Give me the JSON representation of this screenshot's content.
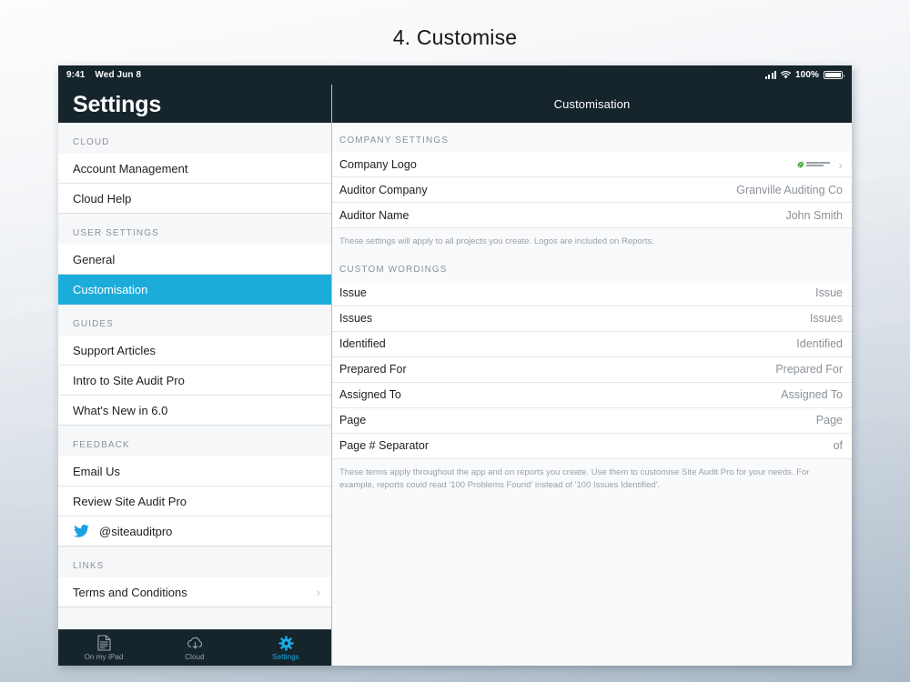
{
  "page": {
    "heading": "4. Customise"
  },
  "statusbar": {
    "time": "9:41",
    "date": "Wed Jun 8",
    "battery_pct": "100%",
    "signal_icon": "cellular-signal-icon",
    "wifi_icon": "wifi-icon",
    "battery_icon": "battery-icon"
  },
  "sidebar": {
    "title": "Settings",
    "sections": [
      {
        "header": "CLOUD",
        "items": [
          {
            "label": "Account Management",
            "selected": false,
            "chevron": false,
            "icon": null
          },
          {
            "label": "Cloud Help",
            "selected": false,
            "chevron": false,
            "icon": null
          }
        ]
      },
      {
        "header": "USER SETTINGS",
        "items": [
          {
            "label": "General",
            "selected": false,
            "chevron": false,
            "icon": null
          },
          {
            "label": "Customisation",
            "selected": true,
            "chevron": false,
            "icon": null
          }
        ]
      },
      {
        "header": "GUIDES",
        "items": [
          {
            "label": "Support Articles",
            "selected": false,
            "chevron": false,
            "icon": null
          },
          {
            "label": "Intro to Site Audit Pro",
            "selected": false,
            "chevron": false,
            "icon": null
          },
          {
            "label": "What's New in 6.0",
            "selected": false,
            "chevron": false,
            "icon": null
          }
        ]
      },
      {
        "header": "FEEDBACK",
        "items": [
          {
            "label": "Email Us",
            "selected": false,
            "chevron": false,
            "icon": null
          },
          {
            "label": "Review Site Audit Pro",
            "selected": false,
            "chevron": false,
            "icon": null
          },
          {
            "label": "@siteauditpro",
            "selected": false,
            "chevron": false,
            "icon": "twitter-icon"
          }
        ]
      },
      {
        "header": "LINKS",
        "items": [
          {
            "label": "Terms and Conditions",
            "selected": false,
            "chevron": true,
            "icon": null
          }
        ]
      }
    ]
  },
  "tabbar": {
    "tabs": [
      {
        "label": "On my iPad",
        "icon": "document-icon",
        "active": false
      },
      {
        "label": "Cloud",
        "icon": "cloud-icon",
        "active": false
      },
      {
        "label": "Settings",
        "icon": "gear-icon",
        "active": true
      }
    ]
  },
  "panel": {
    "nav_title": "Customisation",
    "sections": [
      {
        "header": "COMPANY SETTINGS",
        "footnote": "These settings will apply to all projects you create. Logos are included on Reports.",
        "rows": [
          {
            "label": "Company Logo",
            "value": "",
            "thumbnail": "company-logo-thumbnail",
            "chevron": true
          },
          {
            "label": "Auditor Company",
            "value": "Granville Auditing Co",
            "thumbnail": null,
            "chevron": false
          },
          {
            "label": "Auditor Name",
            "value": "John Smith",
            "thumbnail": null,
            "chevron": false
          }
        ]
      },
      {
        "header": "CUSTOM WORDINGS",
        "footnote": "These terms apply throughout the app and on reports you create. Use them to customise Site Audit Pro for your needs. For example, reports could read '100 Problems Found' instead of '100 Issues Identified'.",
        "rows": [
          {
            "label": "Issue",
            "value": "Issue",
            "thumbnail": null,
            "chevron": false
          },
          {
            "label": "Issues",
            "value": "Issues",
            "thumbnail": null,
            "chevron": false
          },
          {
            "label": "Identified",
            "value": "Identified",
            "thumbnail": null,
            "chevron": false
          },
          {
            "label": "Prepared For",
            "value": "Prepared For",
            "thumbnail": null,
            "chevron": false
          },
          {
            "label": "Assigned To",
            "value": "Assigned To",
            "thumbnail": null,
            "chevron": false
          },
          {
            "label": "Page",
            "value": "Page",
            "thumbnail": null,
            "chevron": false
          },
          {
            "label": "Page # Separator",
            "value": "of",
            "thumbnail": null,
            "chevron": false
          }
        ]
      }
    ]
  },
  "colors": {
    "navy": "#16242c",
    "accent": "#1cacdb",
    "tab_active": "#1ab0e8",
    "twitter_blue": "#1ba1e2",
    "logo_green": "#4aa83b"
  }
}
